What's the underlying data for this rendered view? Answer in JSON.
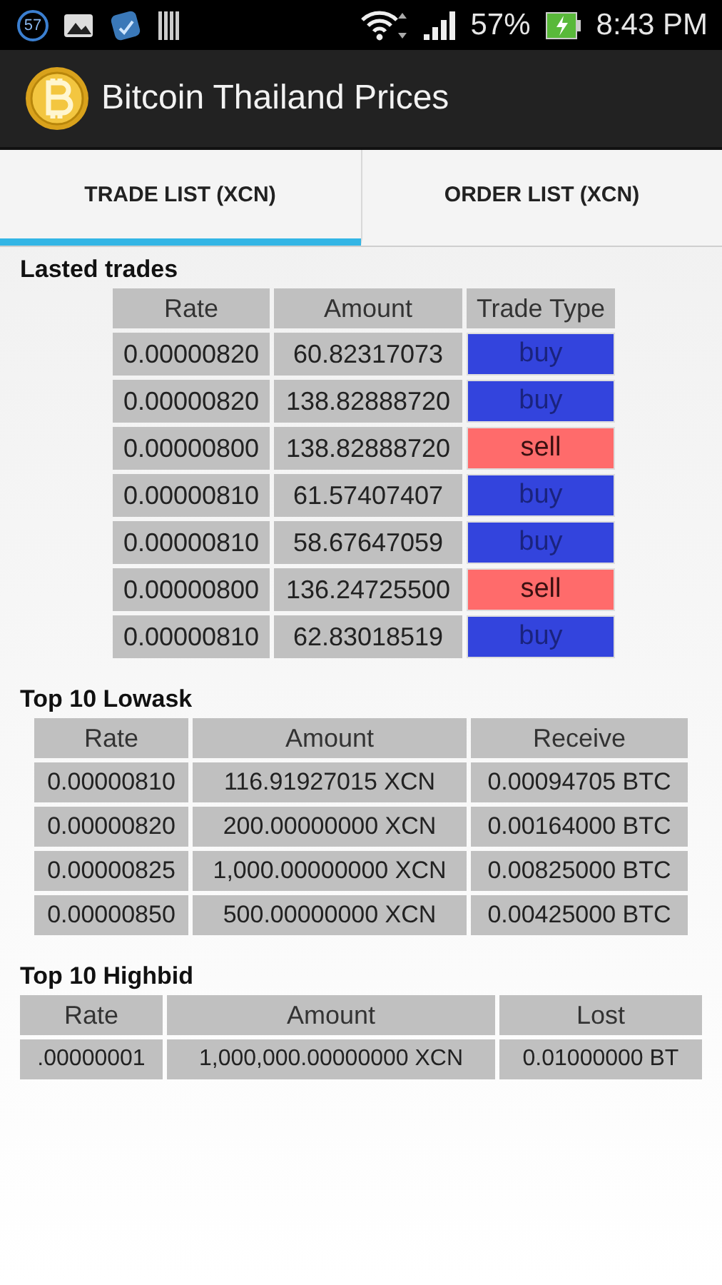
{
  "status_bar": {
    "notification_badge": "57",
    "battery": "57%",
    "time": "8:43 PM"
  },
  "app_bar": {
    "title": "Bitcoin Thailand Prices"
  },
  "tabs": [
    {
      "label": "TRADE LIST (XCN)",
      "selected": true
    },
    {
      "label": "ORDER LIST (XCN)",
      "selected": false
    }
  ],
  "sections": [
    {
      "title": "Lasted trades",
      "columns": [
        "Rate",
        "Amount",
        "Trade Type"
      ],
      "rows": [
        {
          "cells": [
            "0.00000820",
            "60.82317073"
          ],
          "trade_type": {
            "label": "buy",
            "kind": "buy"
          }
        },
        {
          "cells": [
            "0.00000820",
            "138.82888720"
          ],
          "trade_type": {
            "label": "buy",
            "kind": "buy"
          }
        },
        {
          "cells": [
            "0.00000800",
            "138.82888720"
          ],
          "trade_type": {
            "label": "sell",
            "kind": "sell"
          }
        },
        {
          "cells": [
            "0.00000810",
            "61.57407407"
          ],
          "trade_type": {
            "label": "buy",
            "kind": "buy"
          }
        },
        {
          "cells": [
            "0.00000810",
            "58.67647059"
          ],
          "trade_type": {
            "label": "buy",
            "kind": "buy"
          }
        },
        {
          "cells": [
            "0.00000800",
            "136.24725500"
          ],
          "trade_type": {
            "label": "sell",
            "kind": "sell"
          }
        },
        {
          "cells": [
            "0.00000810",
            "62.83018519"
          ],
          "trade_type": {
            "label": "buy",
            "kind": "buy"
          }
        }
      ]
    },
    {
      "title": "Top 10 Lowask",
      "columns": [
        "Rate",
        "Amount",
        "Receive"
      ],
      "rows": [
        {
          "cells": [
            "0.00000810",
            "116.91927015 XCN",
            "0.00094705 BTC"
          ]
        },
        {
          "cells": [
            "0.00000820",
            "200.00000000 XCN",
            "0.00164000 BTC"
          ]
        },
        {
          "cells": [
            "0.00000825",
            "1,000.00000000 XCN",
            "0.00825000 BTC"
          ]
        },
        {
          "cells": [
            "0.00000850",
            "500.00000000 XCN",
            "0.00425000 BTC"
          ]
        }
      ]
    },
    {
      "title": "Top 10 Highbid",
      "columns": [
        "Rate",
        "Amount",
        "Lost"
      ],
      "rows": [
        {
          "cells": [
            ".00000001",
            "1,000,000.00000000 XCN",
            "0.01000000 BT"
          ]
        }
      ]
    }
  ]
}
